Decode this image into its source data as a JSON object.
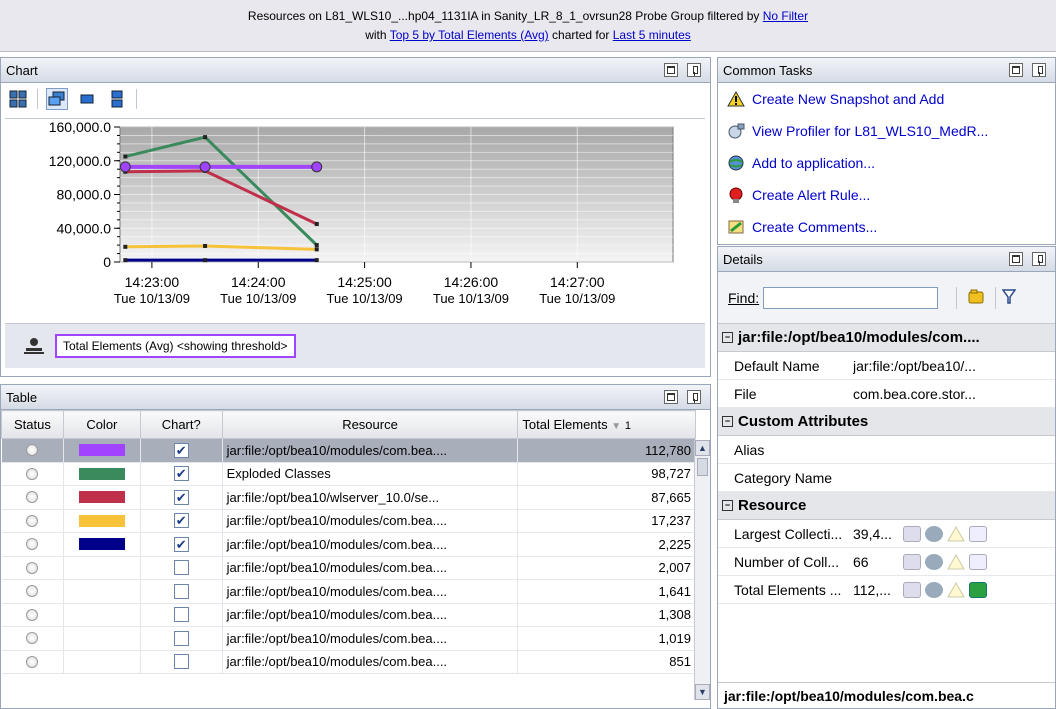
{
  "header": {
    "line1_prefix": "Resources on L81_WLS10_...hp04_1131IA in Sanity_LR_8_1_ovrsun28 Probe Group filtered by",
    "filter_link": "No Filter",
    "line2_with": "with",
    "top_link": "Top 5 by Total Elements (Avg)",
    "line2_mid": "charted for",
    "time_link": "Last 5 minutes"
  },
  "chart_panel": {
    "title": "Chart"
  },
  "chart_legend": {
    "label": "Total Elements (Avg) <showing threshold>"
  },
  "chart_data": {
    "type": "line",
    "y_ticks": [
      "160,000.0",
      "120,000.0",
      "80,000.0",
      "40,000.0",
      "0"
    ],
    "ylim": [
      0,
      160000
    ],
    "x_ticks": [
      {
        "time": "14:23:00",
        "date": "Tue 10/13/09"
      },
      {
        "time": "14:24:00",
        "date": "Tue 10/13/09"
      },
      {
        "time": "14:25:00",
        "date": "Tue 10/13/09"
      },
      {
        "time": "14:26:00",
        "date": "Tue 10/13/09"
      },
      {
        "time": "14:27:00",
        "date": "Tue 10/13/09"
      }
    ],
    "x_minutes": [
      0,
      1,
      2,
      3,
      4
    ],
    "xlim": [
      -0.3,
      4.9
    ],
    "grid": true,
    "series": [
      {
        "color": "#3a8a5e",
        "x": [
          -0.25,
          0.5,
          1.55
        ],
        "values": [
          125000,
          148000,
          20000
        ]
      },
      {
        "color": "#c0304a",
        "x": [
          -0.25,
          0.5,
          1.55
        ],
        "values": [
          107000,
          108000,
          45000
        ]
      },
      {
        "color": "#a044ff",
        "x": [
          -0.25,
          0.5,
          1.55
        ],
        "values": [
          112780,
          112780,
          112780
        ],
        "threshold": true
      },
      {
        "color": "#f5c23a",
        "x": [
          -0.25,
          0.5,
          1.55
        ],
        "values": [
          18000,
          19000,
          15000
        ]
      },
      {
        "color": "#00008b",
        "x": [
          -0.25,
          0.5,
          1.55
        ],
        "values": [
          2200,
          2200,
          2225
        ]
      }
    ]
  },
  "table_panel": {
    "title": "Table",
    "columns": [
      "Status",
      "Color",
      "Chart?",
      "Resource",
      "Total Elements"
    ],
    "sort_indicator": "1",
    "rows": [
      {
        "color": "#a044ff",
        "checked": true,
        "resource": "jar:file:/opt/bea10/modules/com.bea....",
        "value": "112,780",
        "selected": true
      },
      {
        "color": "#3a8a5e",
        "checked": true,
        "resource": "Exploded Classes",
        "value": "98,727"
      },
      {
        "color": "#c0304a",
        "checked": true,
        "resource": "jar:file:/opt/bea10/wlserver_10.0/se...",
        "value": "87,665"
      },
      {
        "color": "#f5c23a",
        "checked": true,
        "resource": "jar:file:/opt/bea10/modules/com.bea....",
        "value": "17,237"
      },
      {
        "color": "#00008b",
        "checked": true,
        "resource": "jar:file:/opt/bea10/modules/com.bea....",
        "value": "2,225"
      },
      {
        "color": "",
        "checked": false,
        "resource": "jar:file:/opt/bea10/modules/com.bea....",
        "value": "2,007"
      },
      {
        "color": "",
        "checked": false,
        "resource": "jar:file:/opt/bea10/modules/com.bea....",
        "value": "1,641"
      },
      {
        "color": "",
        "checked": false,
        "resource": "jar:file:/opt/bea10/modules/com.bea....",
        "value": "1,308"
      },
      {
        "color": "",
        "checked": false,
        "resource": "jar:file:/opt/bea10/modules/com.bea....",
        "value": "1,019"
      },
      {
        "color": "",
        "checked": false,
        "resource": "jar:file:/opt/bea10/modules/com.bea....",
        "value": "851"
      }
    ]
  },
  "tasks_panel": {
    "title": "Common Tasks",
    "items": [
      {
        "label": "Create New Snapshot and Add",
        "icon": "warning-icon"
      },
      {
        "label": "View Profiler for L81_WLS10_MedR...",
        "icon": "profiler-icon"
      },
      {
        "label": "Add to application...",
        "icon": "globe-add-icon"
      },
      {
        "label": "Create Alert Rule...",
        "icon": "alert-bulb-icon"
      },
      {
        "label": "Create Comments...",
        "icon": "comment-icon"
      }
    ]
  },
  "details_panel": {
    "title": "Details",
    "find_label": "Find:",
    "find_value": "",
    "section_jar": "jar:file:/opt/bea10/modules/com....",
    "default_name_key": "Default Name",
    "default_name_val": "jar:file:/opt/bea10/...",
    "file_key": "File",
    "file_val": "com.bea.core.stor...",
    "section_custom": "Custom Attributes",
    "alias_key": "Alias",
    "category_key": "Category Name",
    "section_resource": "Resource",
    "largest_key": "Largest Collecti...",
    "largest_val": "39,4...",
    "number_key": "Number of Coll...",
    "number_val": "66",
    "total_key": "Total Elements ...",
    "total_val": "112,...",
    "footer": "jar:file:/opt/bea10/modules/com.bea.c"
  }
}
